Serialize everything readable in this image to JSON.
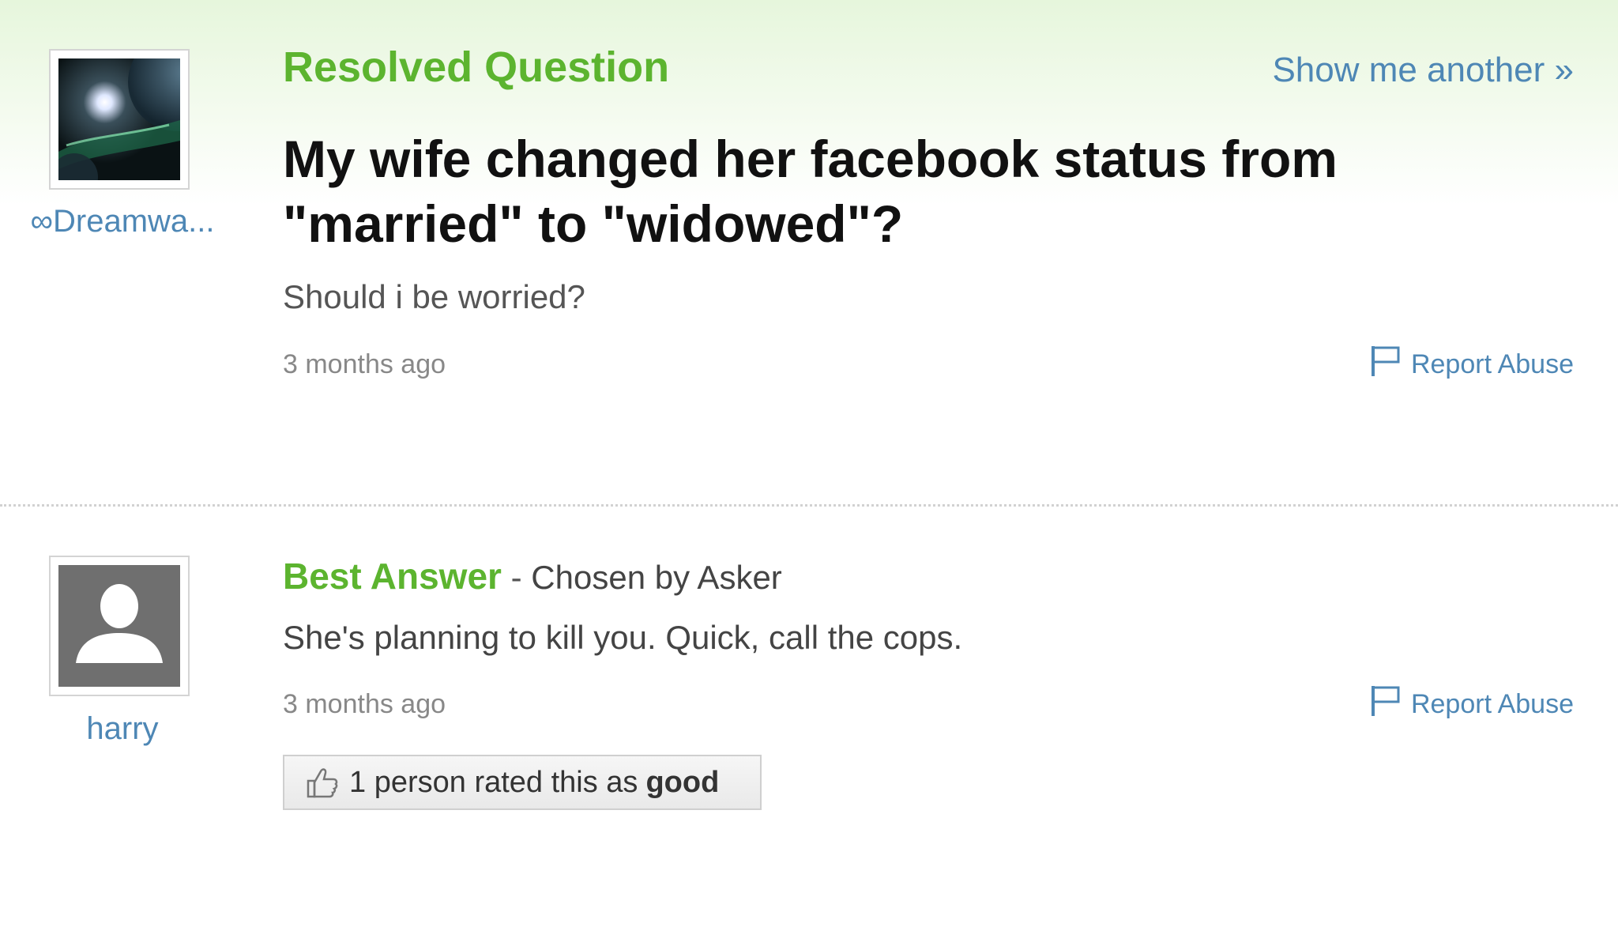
{
  "question": {
    "header": "Resolved Question",
    "show_another": "Show me another »",
    "asker_name": "∞Dreamwa...",
    "title": "My wife changed her facebook status from \"married\" to \"widowed\"?",
    "body": "Should i be worried?",
    "time": "3 months ago",
    "report_label": "Report Abuse"
  },
  "answer": {
    "header": "Best Answer",
    "separator": " - ",
    "chosen_by": "Chosen by Asker",
    "answerer_name": "harry",
    "body": "She's planning to kill you. Quick, call the cops.",
    "time": "3 months ago",
    "report_label": "Report Abuse",
    "rating_text": "1 person rated this as",
    "rating_word": "good"
  },
  "icons": {
    "flag": "flag-icon",
    "thumb": "thumbs-up-icon"
  },
  "colors": {
    "accent_green": "#5cb42f",
    "link_blue": "#4e87b5"
  }
}
